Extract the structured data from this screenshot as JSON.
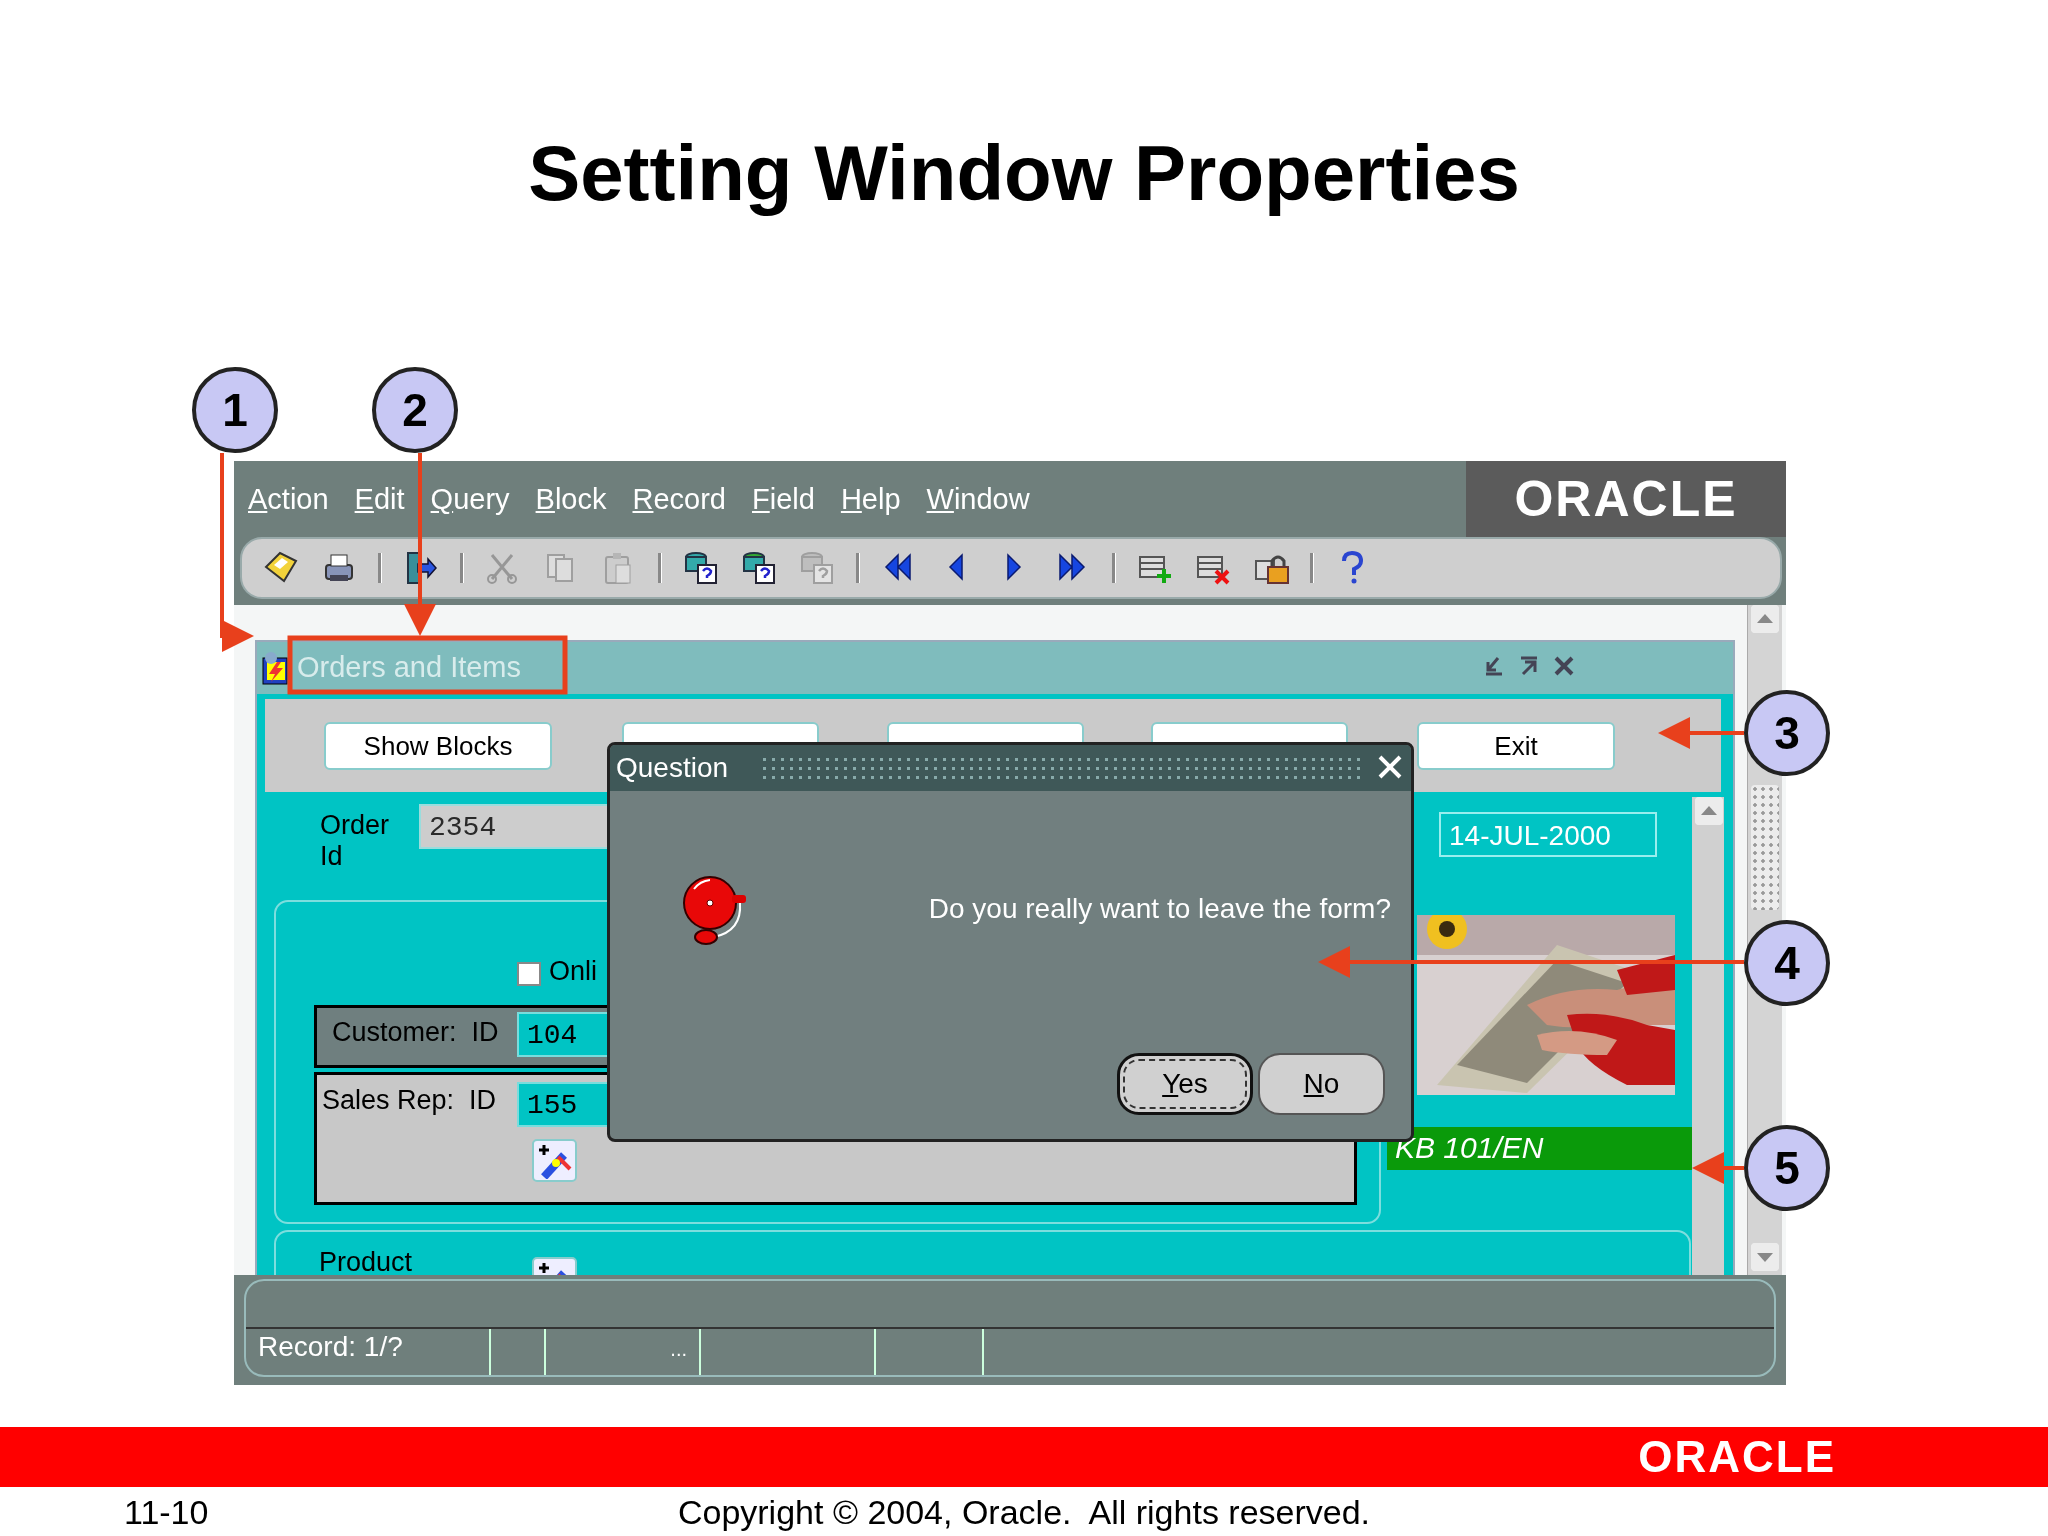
{
  "slide": {
    "title": "Setting Window Properties",
    "page_number": "11-10",
    "copyright": "Copyright © 2004, Oracle.  All rights reserved.",
    "footer_logo": "ORACLE"
  },
  "callouts": [
    {
      "label": "1"
    },
    {
      "label": "2"
    },
    {
      "label": "3"
    },
    {
      "label": "4"
    },
    {
      "label": "5"
    }
  ],
  "app": {
    "menu": [
      {
        "label": "Action"
      },
      {
        "label": "Edit"
      },
      {
        "label": "Query"
      },
      {
        "label": "Block"
      },
      {
        "label": "Record"
      },
      {
        "label": "Field"
      },
      {
        "label": "Help"
      },
      {
        "label": "Window"
      }
    ],
    "logo": "ORACLE",
    "toolbar": [
      [
        {
          "disabled": false
        },
        {
          "disabled": false
        }
      ],
      [
        {
          "disabled": false
        }
      ],
      [
        {
          "disabled": true
        },
        {
          "disabled": true
        },
        {
          "disabled": true
        }
      ],
      [
        {
          "disabled": false
        },
        {
          "disabled": false
        },
        {
          "disabled": true
        }
      ],
      [
        {
          "disabled": false
        },
        {
          "disabled": false
        },
        {
          "disabled": false
        },
        {
          "disabled": false
        }
      ],
      [
        {
          "disabled": false
        },
        {
          "disabled": false
        },
        {
          "disabled": false
        }
      ],
      [
        {
          "disabled": false
        }
      ]
    ],
    "window": {
      "title": "Orders and Items",
      "buttons": [
        {
          "kind": "label",
          "label": "Show Blocks"
        },
        {
          "kind": "covered"
        },
        {
          "kind": "covered"
        },
        {
          "kind": "covered"
        },
        {
          "kind": "label",
          "label": "Exit"
        }
      ],
      "order_id": {
        "label": "Order Id",
        "value": "2354"
      },
      "checkbox": {
        "label": "Onli",
        "checked": false
      },
      "customer": {
        "label": "Customer:  ID",
        "value": "104"
      },
      "sales_rep": {
        "label": "Sales Rep:  ID",
        "value": "155"
      },
      "product_label": "Product",
      "date": "14-JUL-2000",
      "product_code": "KB 101/EN"
    },
    "dialog": {
      "title": "Question",
      "message": "Do you really want to leave the form?",
      "buttons": [
        {
          "label": "Yes",
          "selected": true
        },
        {
          "label": "No",
          "selected": false
        }
      ]
    },
    "status_bar": {
      "record": "Record: 1/?",
      "field_3": "..."
    }
  }
}
